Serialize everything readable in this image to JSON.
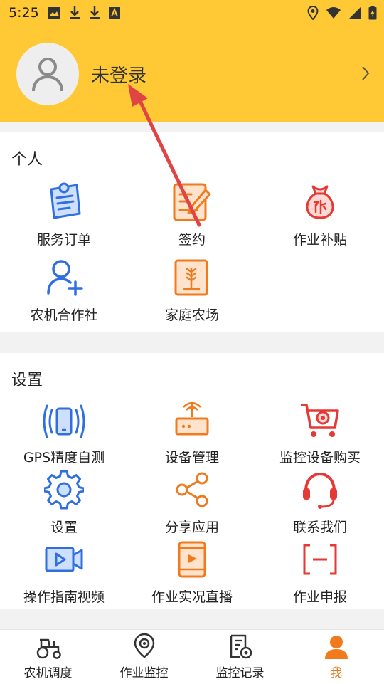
{
  "status_bar": {
    "time": "5:25"
  },
  "header": {
    "login_text": "未登录"
  },
  "personal": {
    "title": "个人",
    "items": [
      {
        "label": "服务订单",
        "icon": "clipboard-icon"
      },
      {
        "label": "签约",
        "icon": "sign-contract-icon"
      },
      {
        "label": "作业补贴",
        "icon": "subsidy-bag-icon"
      },
      {
        "label": "农机合作社",
        "icon": "add-user-icon"
      },
      {
        "label": "家庭农场",
        "icon": "wheat-farm-icon"
      }
    ]
  },
  "settings": {
    "title": "设置",
    "items": [
      {
        "label": "GPS精度自测",
        "icon": "gps-phone-icon"
      },
      {
        "label": "设备管理",
        "icon": "router-icon"
      },
      {
        "label": "监控设备购买",
        "icon": "shopping-cart-icon"
      },
      {
        "label": "设置",
        "icon": "gear-icon"
      },
      {
        "label": "分享应用",
        "icon": "share-icon"
      },
      {
        "label": "联系我们",
        "icon": "headset-icon"
      },
      {
        "label": "操作指南视频",
        "icon": "video-icon"
      },
      {
        "label": "作业实况直播",
        "icon": "live-broadcast-icon"
      },
      {
        "label": "作业申报",
        "icon": "declaration-icon"
      }
    ]
  },
  "tabbar": {
    "tabs": [
      {
        "label": "农机调度",
        "icon": "tractor-icon"
      },
      {
        "label": "作业监控",
        "icon": "location-camera-icon"
      },
      {
        "label": "监控记录",
        "icon": "record-doc-icon"
      },
      {
        "label": "我",
        "icon": "person-icon",
        "active": true
      }
    ]
  },
  "colors": {
    "header": "#ffc935",
    "blue": "#2f6fe0",
    "orange": "#f07a1c",
    "red": "#e53935",
    "active_tab": "#f07a1c",
    "annotation_arrow": "#e04545"
  }
}
